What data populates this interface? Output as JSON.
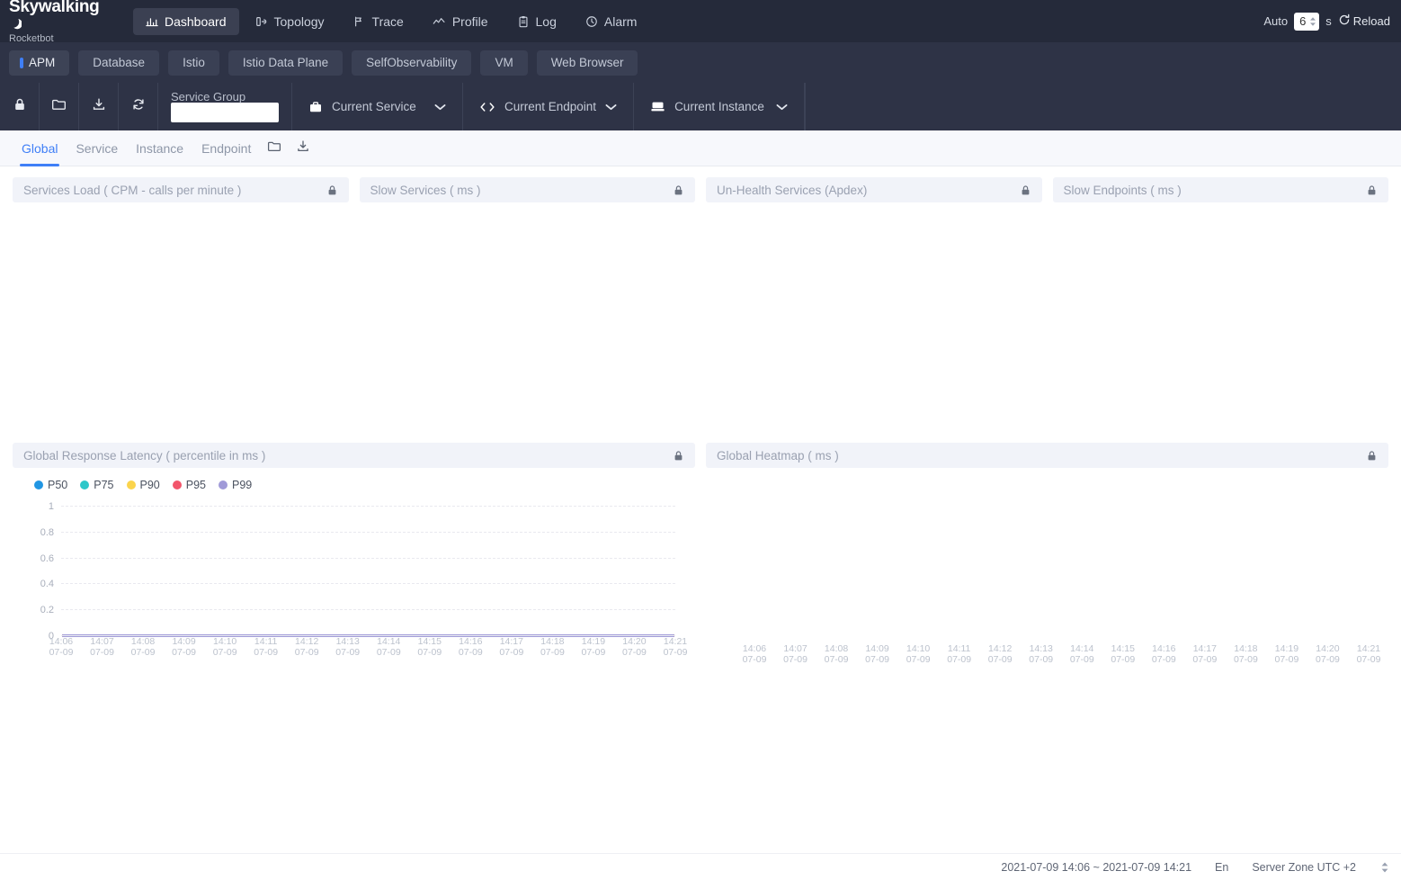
{
  "brand": {
    "name": "Skywalking",
    "sub": "Rocketbot"
  },
  "topnav": {
    "items": [
      {
        "label": "Dashboard",
        "icon": "dashboard-icon",
        "active": true
      },
      {
        "label": "Topology",
        "icon": "topology-icon",
        "active": false
      },
      {
        "label": "Trace",
        "icon": "trace-icon",
        "active": false
      },
      {
        "label": "Profile",
        "icon": "profile-icon",
        "active": false
      },
      {
        "label": "Log",
        "icon": "log-icon",
        "active": false
      },
      {
        "label": "Alarm",
        "icon": "alarm-icon",
        "active": false
      }
    ],
    "auto_label": "Auto",
    "auto_value": "6",
    "auto_unit": "s",
    "reload_label": "Reload"
  },
  "subnav": {
    "items": [
      {
        "label": "APM",
        "active": true
      },
      {
        "label": "Database",
        "active": false
      },
      {
        "label": "Istio",
        "active": false
      },
      {
        "label": "Istio Data Plane",
        "active": false
      },
      {
        "label": "SelfObservability",
        "active": false
      },
      {
        "label": "VM",
        "active": false
      },
      {
        "label": "Web Browser",
        "active": false
      }
    ]
  },
  "toolbar": {
    "icons": [
      "lock-icon",
      "folder-icon",
      "download-icon",
      "refresh-icon"
    ],
    "service_group_label": "Service Group",
    "service_group_value": "",
    "selects": [
      {
        "label": "Current Service",
        "icon": "briefcase-icon"
      },
      {
        "label": "Current Endpoint",
        "icon": "code-brackets-icon"
      },
      {
        "label": "Current Instance",
        "icon": "server-icon"
      }
    ]
  },
  "pagetabs": {
    "items": [
      {
        "label": "Global",
        "active": true
      },
      {
        "label": "Service",
        "active": false
      },
      {
        "label": "Instance",
        "active": false
      },
      {
        "label": "Endpoint",
        "active": false
      }
    ],
    "icons": [
      "folder-icon",
      "download-icon"
    ]
  },
  "cards_top": [
    {
      "title": "Services Load ( CPM - calls per minute )",
      "lock": "lock-icon"
    },
    {
      "title": "Slow Services ( ms )",
      "lock": "lock-icon"
    },
    {
      "title": "Un-Health Services (Apdex)",
      "lock": "lock-icon"
    },
    {
      "title": "Slow Endpoints ( ms )",
      "lock": "lock-icon"
    }
  ],
  "cards_bottom": [
    {
      "title": "Global Response Latency ( percentile in ms )",
      "lock": "lock-icon"
    },
    {
      "title": "Global Heatmap ( ms )",
      "lock": "lock-icon"
    }
  ],
  "footer": {
    "time_range": "2021-07-09 14:06 ~ 2021-07-09 14:21",
    "language": "En",
    "timezone": "Server Zone UTC +2"
  },
  "chart_data": {
    "type": "line",
    "title": "Global Response Latency ( percentile in ms )",
    "xlabel": "",
    "ylabel": "",
    "ylim": [
      0,
      1
    ],
    "yticks": [
      1,
      0.8,
      0.6,
      0.4,
      0.2,
      0
    ],
    "ytick_labels": [
      "1",
      "0.8",
      "0.6",
      "0.4",
      "0.2",
      "0"
    ],
    "grid": true,
    "legend_position": "top-left",
    "x": [
      "14:06\n07-09",
      "14:07\n07-09",
      "14:08\n07-09",
      "14:09\n07-09",
      "14:10\n07-09",
      "14:11\n07-09",
      "14:12\n07-09",
      "14:13\n07-09",
      "14:14\n07-09",
      "14:15\n07-09",
      "14:16\n07-09",
      "14:17\n07-09",
      "14:18\n07-09",
      "14:19\n07-09",
      "14:20\n07-09",
      "14:21\n07-09"
    ],
    "x_times": [
      "14:06",
      "14:07",
      "14:08",
      "14:09",
      "14:10",
      "14:11",
      "14:12",
      "14:13",
      "14:14",
      "14:15",
      "14:16",
      "14:17",
      "14:18",
      "14:19",
      "14:20",
      "14:21"
    ],
    "x_dates": [
      "07-09",
      "07-09",
      "07-09",
      "07-09",
      "07-09",
      "07-09",
      "07-09",
      "07-09",
      "07-09",
      "07-09",
      "07-09",
      "07-09",
      "07-09",
      "07-09",
      "07-09",
      "07-09"
    ],
    "series": [
      {
        "name": "P50",
        "color": "#2196e3",
        "values": [
          0,
          0,
          0,
          0,
          0,
          0,
          0,
          0,
          0,
          0,
          0,
          0,
          0,
          0,
          0,
          0
        ]
      },
      {
        "name": "P75",
        "color": "#2ec7c9",
        "values": [
          0,
          0,
          0,
          0,
          0,
          0,
          0,
          0,
          0,
          0,
          0,
          0,
          0,
          0,
          0,
          0
        ]
      },
      {
        "name": "P90",
        "color": "#fbd44c",
        "values": [
          0,
          0,
          0,
          0,
          0,
          0,
          0,
          0,
          0,
          0,
          0,
          0,
          0,
          0,
          0,
          0
        ]
      },
      {
        "name": "P95",
        "color": "#f2556b",
        "values": [
          0,
          0,
          0,
          0,
          0,
          0,
          0,
          0,
          0,
          0,
          0,
          0,
          0,
          0,
          0,
          0
        ]
      },
      {
        "name": "P99",
        "color": "#a09ad8",
        "values": [
          0,
          0,
          0,
          0,
          0,
          0,
          0,
          0,
          0,
          0,
          0,
          0,
          0,
          0,
          0,
          0
        ]
      }
    ]
  },
  "heatmap_data": {
    "type": "heatmap",
    "title": "Global Heatmap ( ms )",
    "x_times": [
      "14:06",
      "14:07",
      "14:08",
      "14:09",
      "14:10",
      "14:11",
      "14:12",
      "14:13",
      "14:14",
      "14:15",
      "14:16",
      "14:17",
      "14:18",
      "14:19",
      "14:20",
      "14:21"
    ],
    "x_dates": [
      "07-09",
      "07-09",
      "07-09",
      "07-09",
      "07-09",
      "07-09",
      "07-09",
      "07-09",
      "07-09",
      "07-09",
      "07-09",
      "07-09",
      "07-09",
      "07-09",
      "07-09",
      "07-09"
    ],
    "cells": []
  }
}
